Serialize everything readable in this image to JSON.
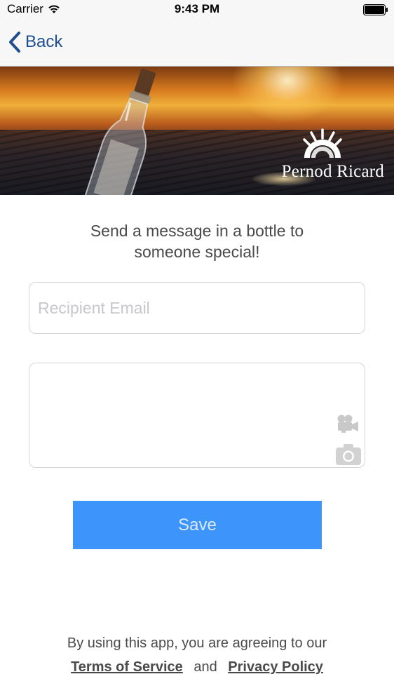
{
  "status_bar": {
    "carrier": "Carrier",
    "time": "9:43 PM",
    "wifi_icon": "wifi-icon",
    "battery_icon": "battery-icon"
  },
  "nav": {
    "back_label": "Back",
    "back_icon": "chevron-left-icon"
  },
  "banner": {
    "brand": "Pernod Ricard"
  },
  "form": {
    "headline": "Send a message in a bottle to someone special!",
    "email_placeholder": "Recipient Email",
    "email_value": "",
    "message_value": "",
    "video_icon": "video-camera-icon",
    "camera_icon": "camera-icon",
    "save_label": "Save"
  },
  "footer": {
    "prefix": "By using this app, you are agreeing to our",
    "terms_label": "Terms of Service",
    "and_label": "and",
    "privacy_label": "Privacy Policy"
  },
  "colors": {
    "accent": "#3d95fb",
    "nav_tint": "#1f4e8f",
    "text": "#4a4a4a",
    "placeholder": "#c7c7cd"
  }
}
